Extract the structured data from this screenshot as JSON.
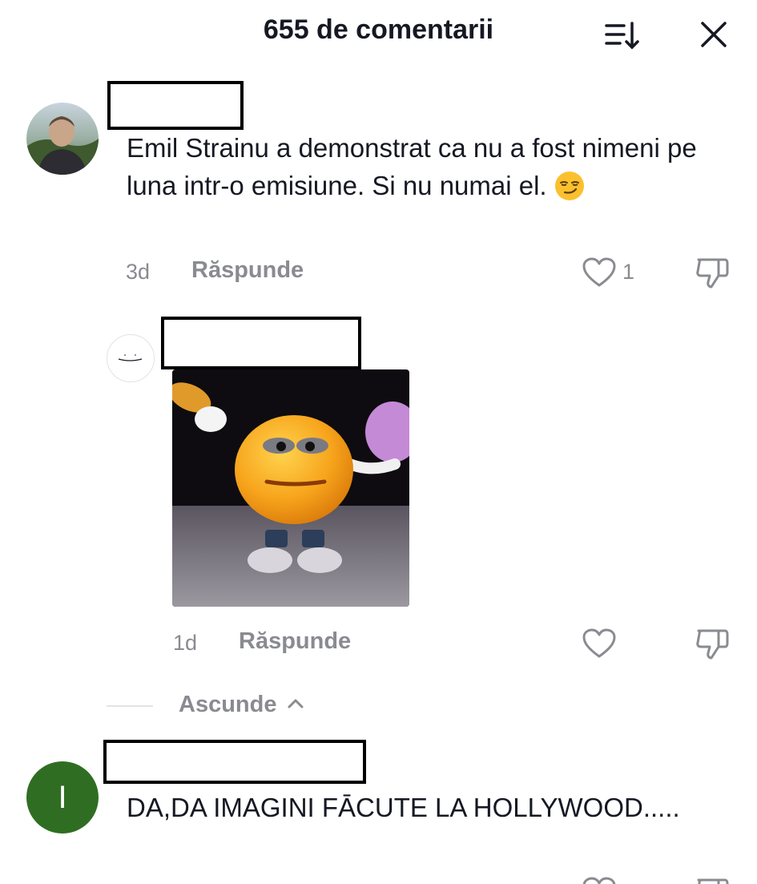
{
  "header": {
    "title": "655 de comentarii",
    "sort_icon": "sort-icon",
    "close_icon": "close-icon"
  },
  "comments": [
    {
      "text": "Emil Strainu a demonstrat ca nu a fost nimeni pe luna intr-o emisiune. Si nu numai el.",
      "emoji": "smirking-face",
      "time": "3d",
      "reply_label": "Răspunde",
      "likes": "1"
    },
    {
      "time": "1d",
      "reply_label": "Răspunde",
      "image": "emoji-character-gif"
    },
    {
      "avatar_letter": "I",
      "text": "DA,DA IMAGINI FĀCUTE LA HOLLYWOOD.....",
      "avatar_color": "#2f6e22"
    }
  ],
  "hide_replies": {
    "label": "Ascunde"
  },
  "colors": {
    "text": "#161823",
    "muted": "#8a8b91",
    "divider": "#e3e3e5"
  }
}
